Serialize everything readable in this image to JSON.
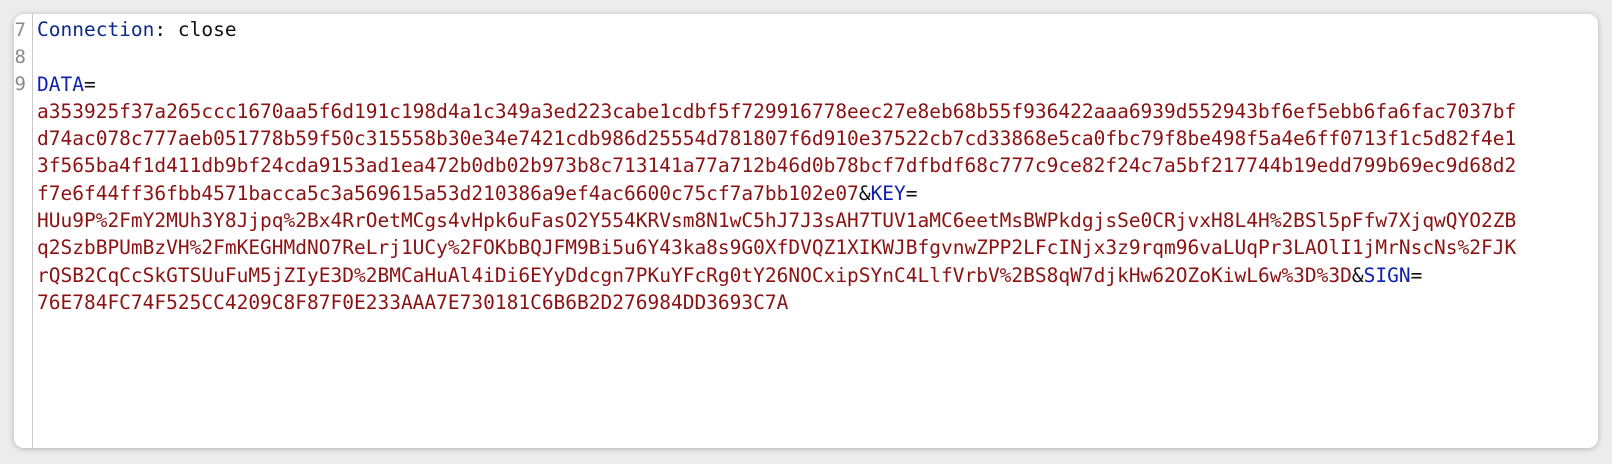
{
  "gutter": {
    "line_numbers": [
      "7",
      "8",
      "9"
    ]
  },
  "editor": {
    "header_line": {
      "name": "Connection",
      "separator": ": ",
      "value": "close"
    },
    "body": {
      "data_key": "DATA",
      "data_value": "a353925f37a265ccc1670aa5f6d191c198d4a1c349a3ed223cabe1cdbf5f729916778eec27e8eb68b55f936422aaa6939d552943bf6ef5ebb6fa6fac7037bfd74ac078c777aeb051778b59f50c315558b30e34e7421cdb986d25554d781807f6d910e37522cb7cd33868e5ca0fbc79f8be498f5a4e6ff0713f1c5d82f4e13f565ba4f1d411db9bf24cda9153ad1ea472b0db02b973b8c713141a77a712b46d0b78bcf7dfbdf68c777c9ce82f24c7a5bf217744b19edd799b69ec9d68d2f7e6f44ff36fbb4571bacca5c3a569615a53d210386a9ef4ac6600c75cf7a7bb102e07",
      "key_key": "KEY",
      "key_value": "HUu9P%2FmY2MUh3Y8Jjpq%2Bx4RrOetMCgs4vHpk6uFasO2Y554KRVsm8N1wC5hJ7J3sAH7TUV1aMC6eetMsBWPkdgjsSe0CRjvxH8L4H%2BSl5pFfw7XjqwQYO2ZBq2SzbBPUmBzVH%2FmKEGHMdNO7ReLrj1UCy%2FOKbBQJFM9Bi5u6Y43ka8s9G0XfDVQZ1XIKWJBfgvnwZPP2LFcINjx3z9rqm96vaLUqPr3LAOlI1jMrNscNs%2FJKrQSB2CqCcSkGTSUuFuM5jZIyE3D%2BMCaHuAl4iDi6EYyDdcgn7PKuYFcRg0tY26NOCxipSYnC4LlfVrbV%2BS8qW7djkHw62OZoKiwL6w%3D%3D",
      "sign_key": "SIGN",
      "sign_value": "76E784FC74F525CC4209C8F87F0E233AAA7E730181C6B6B2D276984DD3693C7A",
      "eq": "=",
      "amp": "&"
    }
  }
}
